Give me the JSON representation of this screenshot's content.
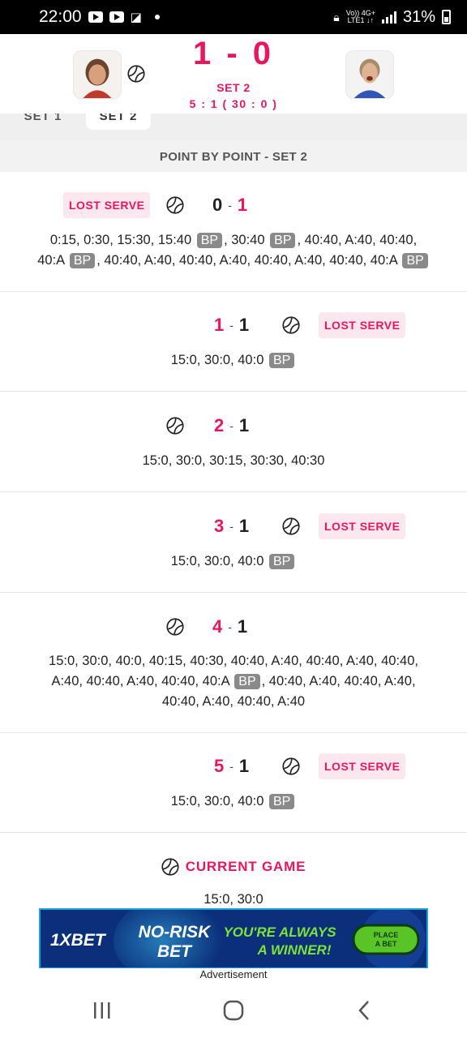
{
  "status_bar": {
    "time": "22:00",
    "network_top": "Vo)) 4G+",
    "network_bottom": "LTE1 ↓↑",
    "battery": "31%"
  },
  "match": {
    "score": "1 - 0",
    "set_label": "SET 2",
    "game_score": "5 : 1 ( 30 : 0 )"
  },
  "tabs": [
    {
      "label": "SET 1"
    },
    {
      "label": "SET 2"
    }
  ],
  "section_title": "POINT BY POINT - SET 2",
  "lost_serve_label": "LOST SERVE",
  "bp_label": "BP",
  "games": [
    {
      "score_left": "0",
      "score_right": "1",
      "line1": [
        "0:15, 0:30, 15:30, 15:40",
        "BP",
        ", 30:40",
        "BP",
        ", 40:40, A:40, 40:40,"
      ],
      "line2": [
        "40:A",
        "BP",
        ", 40:40, A:40, 40:40, A:40, 40:40, A:40, 40:40, 40:A",
        "BP"
      ]
    },
    {
      "score_left": "1",
      "score_right": "1",
      "line1": [
        "15:0, 30:0, 40:0",
        "BP"
      ]
    },
    {
      "score_left": "2",
      "score_right": "1",
      "line1": [
        "15:0, 30:0, 30:15, 30:30, 40:30"
      ]
    },
    {
      "score_left": "3",
      "score_right": "1",
      "line1": [
        "15:0, 30:0, 40:0",
        "BP"
      ]
    },
    {
      "score_left": "4",
      "score_right": "1",
      "line1": [
        "15:0, 30:0, 40:0, 40:15, 40:30, 40:40, A:40, 40:40, A:40, 40:40,"
      ],
      "line2": [
        "A:40, 40:40, A:40, 40:40, 40:A",
        "BP",
        ", 40:40, A:40, 40:40, A:40,"
      ],
      "line3": [
        "40:40, A:40, 40:40, A:40"
      ]
    },
    {
      "score_left": "5",
      "score_right": "1",
      "line1": [
        "15:0, 30:0, 40:0",
        "BP"
      ]
    }
  ],
  "current_game": {
    "title": "CURRENT GAME",
    "points": "15:0, 30:0"
  },
  "ad": {
    "brand": "1XBET",
    "headline_1": "NO-RISK",
    "headline_2": "BET",
    "tagline_1": "YOU'RE ALWAYS",
    "tagline_2": "A WINNER!",
    "cta_1": "PLACE",
    "cta_2": "A BET",
    "label": "Advertisement"
  },
  "colors": {
    "accent": "#e8175d",
    "lost_serve_bg": "#fde7ee",
    "bp_bg": "#8a8a8a"
  },
  "icons": [
    "tennis-ball-icon",
    "recent-apps-icon",
    "home-icon",
    "back-icon"
  ]
}
